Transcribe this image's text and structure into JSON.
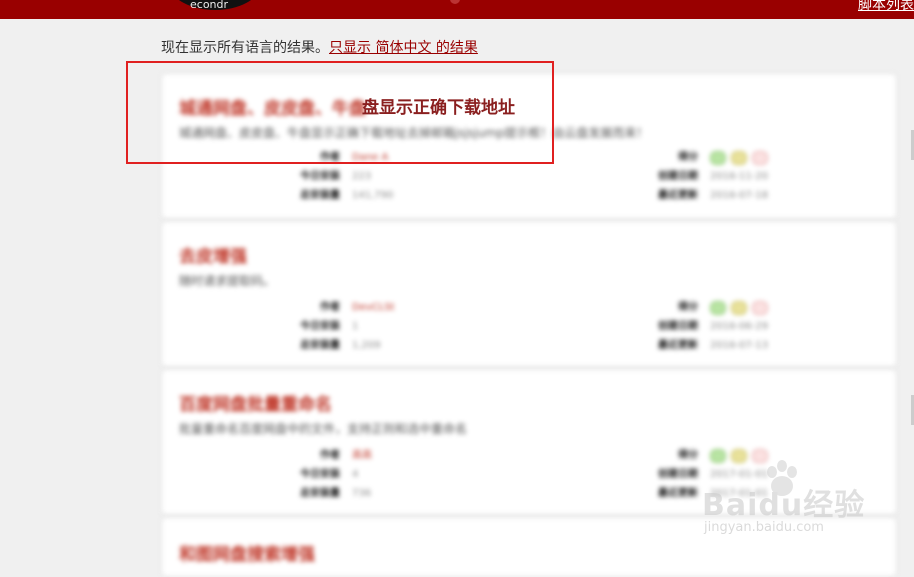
{
  "topbar": {
    "logo_text": "econdr",
    "right_link": "脚本列表"
  },
  "lang_note": {
    "prefix": "现在显示所有语言的结果。",
    "link": "只显示 简体中文 的结果"
  },
  "results": [
    {
      "title": "城通网盘、皮皮盘、牛盘",
      "title_sharp": "盘显示正确下载地址",
      "desc": "城通网盘、皮皮盘、牛盘显示正确下载地址去掉邮箱jsjsjump提示框！由云盘发展而来！",
      "author_label": "作者",
      "author": "Dane A",
      "today_label": "今日安装",
      "today": "223",
      "total_label": "总安装量",
      "total": "141,790",
      "rating_label": "得分",
      "created_label": "创建日期",
      "created": "2016-11-20",
      "updated_label": "最近更新",
      "updated": "2016-07-18"
    },
    {
      "title": "去皮增强",
      "desc": "随时请求提取码。",
      "author_label": "作者",
      "author": "DevCLSt",
      "today_label": "今日安装",
      "today": "1",
      "total_label": "总安装量",
      "total": "1,209",
      "rating_label": "得分",
      "created_label": "创建日期",
      "created": "2016-06-29",
      "updated_label": "最近更新",
      "updated": "2016-07-13"
    },
    {
      "title": "百度网盘批量重命名",
      "desc": "批量重命名百度网盘中的文件，支持正则和选中重命名",
      "author_label": "作者",
      "author": "高高",
      "today_label": "今日安装",
      "today": "4",
      "total_label": "总安装量",
      "total": "736",
      "rating_label": "得分",
      "created_label": "创建日期",
      "created": "2017-01-01",
      "updated_label": "最近更新",
      "updated": "2017-01-01"
    },
    {
      "title": "和图网盘搜索增强"
    }
  ],
  "watermark": {
    "main": "Baidu经验",
    "sub": "jingyan.baidu.com"
  },
  "colors": {
    "brand": "#990000",
    "highlight": "#e02020",
    "title": "#c0392b"
  }
}
